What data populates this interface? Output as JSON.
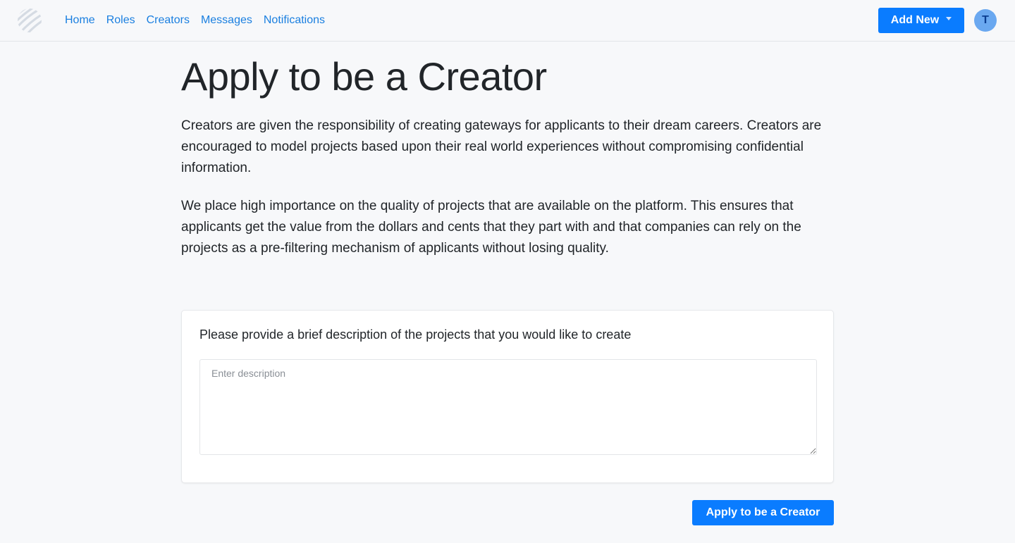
{
  "nav": {
    "links": [
      "Home",
      "Roles",
      "Creators",
      "Messages",
      "Notifications"
    ],
    "add_new_label": "Add New",
    "avatar_initial": "T"
  },
  "main": {
    "title": "Apply to be a Creator",
    "paragraph1": "Creators are given the responsibility of creating gateways for applicants to their dream careers. Creators are encouraged to model projects based upon their real world experiences without compromising confidential information.",
    "paragraph2": "We place high importance on the quality of projects that are available on the platform. This ensures that applicants get the value from the dollars and cents that they part with and that companies can rely on the projects as a pre-filtering mechanism of applicants without losing quality.",
    "form": {
      "label": "Please provide a brief description of the projects that you would like to create",
      "placeholder": "Enter description",
      "value": ""
    },
    "submit_label": "Apply to be a Creator"
  },
  "colors": {
    "accent": "#0a7cff",
    "link": "#1a7fe0",
    "background": "#f7f8fa",
    "avatar": "#6aa8f0"
  },
  "icons": {
    "logo": "striped-circle-logo-icon",
    "dropdown": "caret-down-icon"
  }
}
